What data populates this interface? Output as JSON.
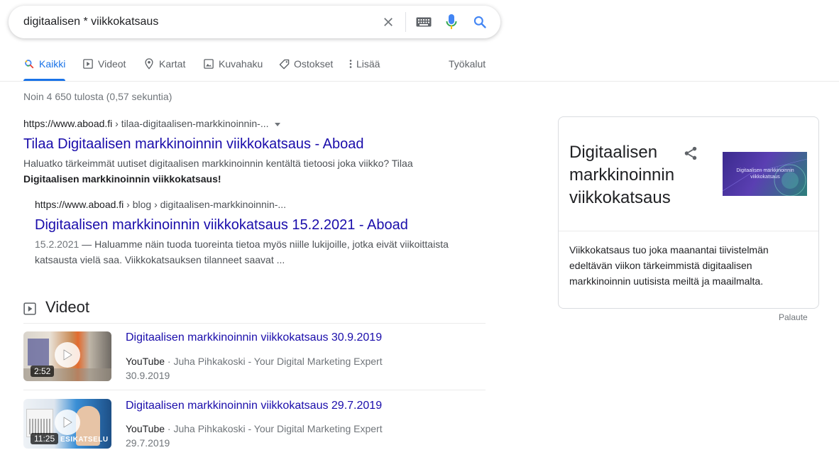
{
  "search": {
    "query": "digitaalisen * viikkokatsaus"
  },
  "tabs": [
    {
      "label": "Kaikki",
      "icon": "search-icon"
    },
    {
      "label": "Videot",
      "icon": "video-icon"
    },
    {
      "label": "Kartat",
      "icon": "map-pin-icon"
    },
    {
      "label": "Kuvahaku",
      "icon": "image-icon"
    },
    {
      "label": "Ostokset",
      "icon": "tag-icon"
    },
    {
      "label": "Lisää",
      "icon": "more-vert-icon"
    }
  ],
  "tools_label": "Työkalut",
  "stats": "Noin 4 650 tulosta (0,57 sekuntia)",
  "results": [
    {
      "cite_domain": "https://www.aboad.fi",
      "cite_path": " › tilaa-digitaalisen-markkinoinnin-...",
      "title": "Tilaa Digitaalisen markkinoinnin viikkokatsaus - Aboad",
      "snippet_1": "Haluatko tärkeimmät uutiset digitaalisen markkinoinnin kentältä tietoosi joka viikko? Tilaa ",
      "snippet_bold": "Digitaalisen markkinoinnin viikkokatsaus",
      "snippet_2": "!"
    },
    {
      "cite_domain": "https://www.aboad.fi",
      "cite_path": " › blog › digitaalisen-markkinoinnin-...",
      "title": "Digitaalisen markkinoinnin viikkokatsaus 15.2.2021 - Aboad",
      "date": "15.2.2021",
      "snippet": " — Haluamme näin tuoda tuoreinta tietoa myös niille lukijoille, jotka eivät viikoittaista katsausta vielä saa. Viikkokatsauksen tilanneet saavat ..."
    }
  ],
  "videos": {
    "heading": "Videot",
    "items": [
      {
        "title": "Digitaalisen markkinoinnin viikkokatsaus 30.9.2019",
        "source": "YouTube",
        "channel": " · Juha Pihkakoski - Your Digital Marketing Expert",
        "date": "30.9.2019",
        "duration": "2:52"
      },
      {
        "title": "Digitaalisen markkinoinnin viikkokatsaus 29.7.2019",
        "source": "YouTube",
        "channel": " · Juha Pihkakoski - Your Digital Marketing Expert",
        "date": "29.7.2019",
        "duration": "11:25",
        "overlay": "ESIKATSELU"
      }
    ]
  },
  "knowledge_panel": {
    "title": "Digitaalisen markkinoinnin viikkokatsaus",
    "image_label": "Digitaalisen markkinoinnin viikkokatsaus",
    "description": "Viikkokatsaus tuo joka maanantai tiivistelmän edeltävän viikon tärkeimmistä digitaalisen markkinoinnin uutisista meiltä ja maailmalta.",
    "feedback": "Palaute"
  },
  "colors": {
    "link": "#1a0dab",
    "accent": "#1a73e8"
  }
}
